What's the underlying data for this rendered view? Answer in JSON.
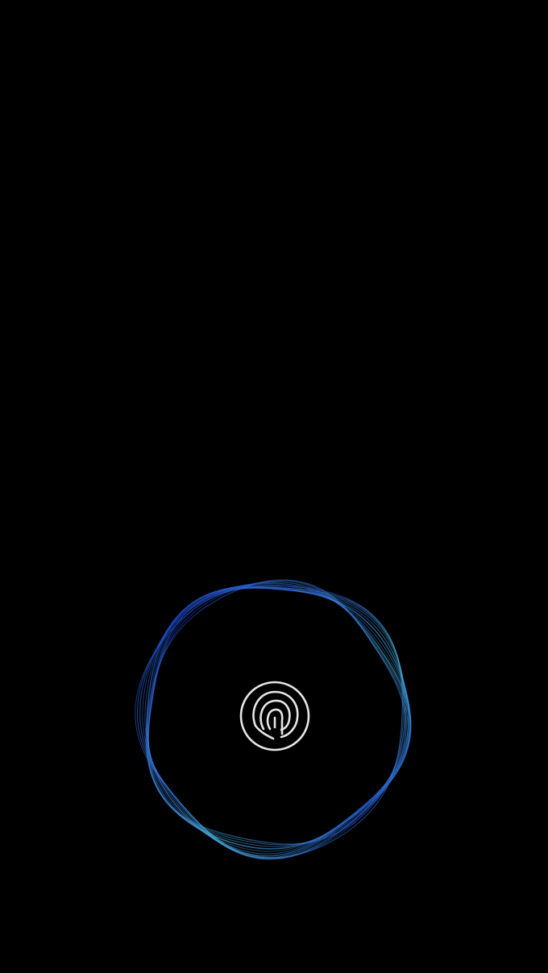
{
  "screen": {
    "background": "#000000",
    "state": "locked"
  },
  "fingerprint_prompt": {
    "icon": "fingerprint-icon",
    "icon_color": "#E6E6E6",
    "ring_colors": {
      "blue": "#1E4FE0",
      "cyan": "#4FC3E8"
    }
  }
}
